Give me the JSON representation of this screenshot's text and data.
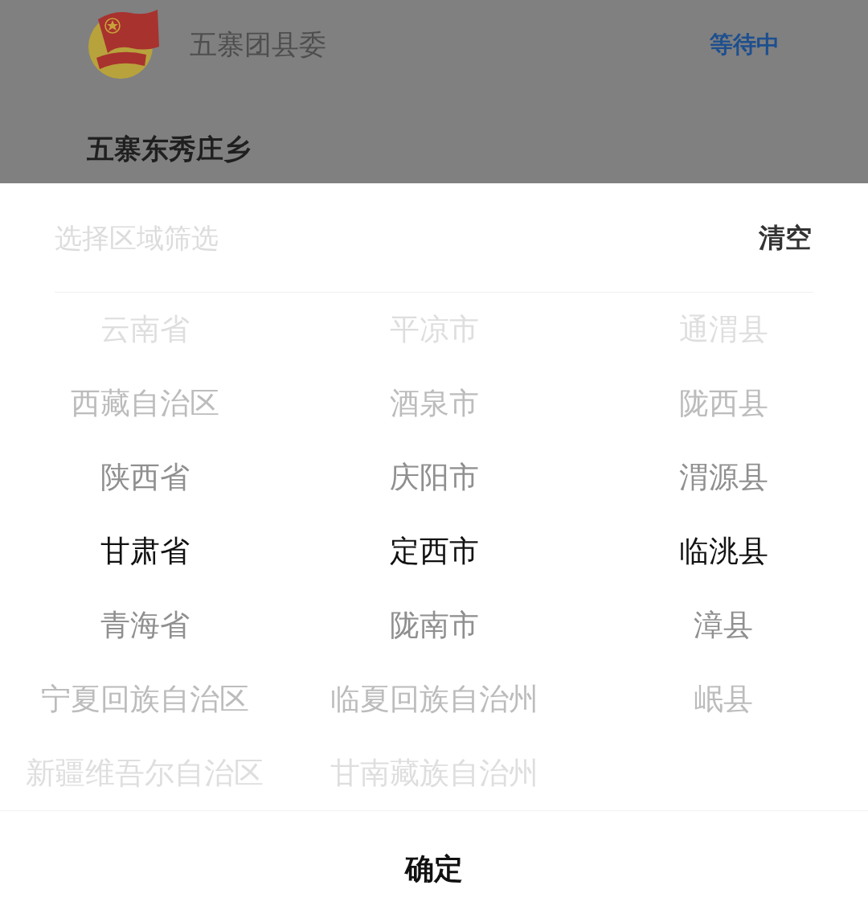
{
  "card": {
    "org_name": "五寨团县委",
    "status": "等待中",
    "location": "五寨东秀庄乡"
  },
  "sheet": {
    "title": "选择区域筛选",
    "clear_button": "清空",
    "columns": [
      {
        "items": [
          {
            "label": "云南省",
            "selected": false
          },
          {
            "label": "西藏自治区",
            "selected": false
          },
          {
            "label": "陕西省",
            "selected": false
          },
          {
            "label": "甘肃省",
            "selected": true
          },
          {
            "label": "青海省",
            "selected": false
          },
          {
            "label": "宁夏回族自治区",
            "selected": false
          },
          {
            "label": "新疆维吾尔自治区",
            "selected": false
          }
        ]
      },
      {
        "items": [
          {
            "label": "平凉市",
            "selected": false
          },
          {
            "label": "酒泉市",
            "selected": false
          },
          {
            "label": "庆阳市",
            "selected": false
          },
          {
            "label": "定西市",
            "selected": true
          },
          {
            "label": "陇南市",
            "selected": false
          },
          {
            "label": "临夏回族自治州",
            "selected": false
          },
          {
            "label": "甘南藏族自治州",
            "selected": false
          }
        ]
      },
      {
        "items": [
          {
            "label": "通渭县",
            "selected": false
          },
          {
            "label": "陇西县",
            "selected": false
          },
          {
            "label": "渭源县",
            "selected": false
          },
          {
            "label": "临洮县",
            "selected": true
          },
          {
            "label": "漳县",
            "selected": false
          },
          {
            "label": "岷县",
            "selected": false
          }
        ]
      }
    ],
    "confirm_button": "确定"
  }
}
